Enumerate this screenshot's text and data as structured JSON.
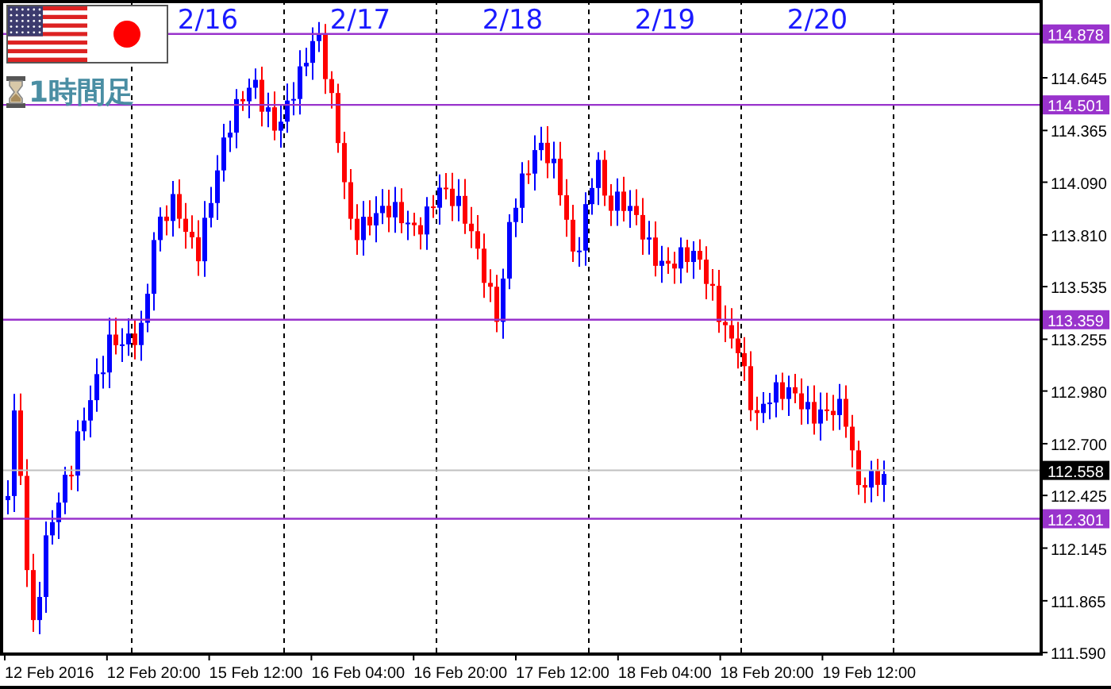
{
  "header": {
    "timeframe": "1時間足"
  },
  "date_labels": [
    "2/16",
    "2/17",
    "2/18",
    "2/19",
    "2/20"
  ],
  "price_axis": {
    "ticks": [
      "114.645",
      "114.365",
      "114.090",
      "113.810",
      "113.535",
      "113.255",
      "112.980",
      "112.700",
      "112.425",
      "112.145",
      "111.865",
      "111.590"
    ]
  },
  "levels": [
    {
      "label": "114.878"
    },
    {
      "label": "114.501"
    },
    {
      "label": "113.359"
    },
    {
      "label": "112.301"
    }
  ],
  "current_price": "112.558",
  "time_axis": [
    "12 Feb 2016",
    "12 Feb 20:00",
    "15 Feb 12:00",
    "16 Feb 04:00",
    "16 Feb 20:00",
    "17 Feb 12:00",
    "18 Feb 04:00",
    "18 Feb 20:00",
    "19 Feb 12:00"
  ]
}
